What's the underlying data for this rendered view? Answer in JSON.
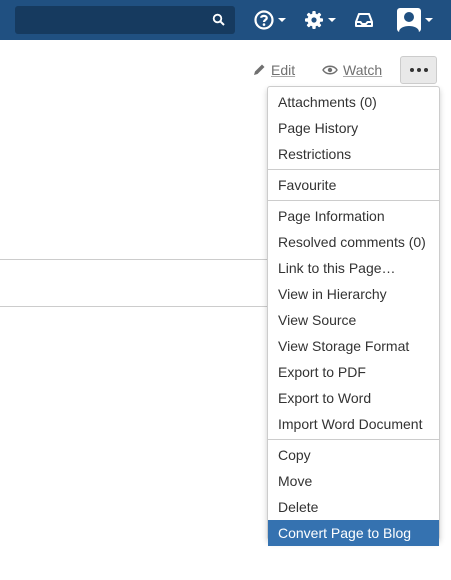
{
  "header": {
    "search_placeholder": "",
    "help_icon": "help-icon",
    "settings_icon": "gear-icon",
    "notifications_icon": "inbox-icon",
    "profile_icon": "user-icon",
    "bar_color": "#205081"
  },
  "page_actions": {
    "edit_label": "Edit",
    "watch_label": "Watch",
    "more_icon": "ellipsis-icon"
  },
  "menu": {
    "groups": [
      [
        "Attachments (0)",
        "Page History",
        "Restrictions"
      ],
      [
        "Favourite"
      ],
      [
        "Page Information",
        "Resolved comments (0)",
        "Link to this Page…",
        "View in Hierarchy",
        "View Source",
        "View Storage Format",
        "Export to PDF",
        "Export to Word",
        "Import Word Document"
      ],
      [
        "Copy",
        "Move",
        "Delete",
        "Convert Page to Blog"
      ]
    ],
    "highlighted_item": "Convert Page to Blog",
    "highlight_color": "#3572b0"
  }
}
